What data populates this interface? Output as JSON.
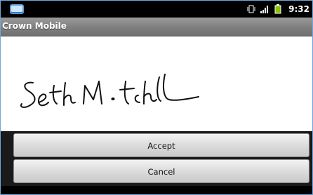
{
  "statusbar": {
    "left_icon": "android-system-icon",
    "icons": [
      "vibrate-icon",
      "signal-bars-icon",
      "battery-icon"
    ],
    "time": "9:32"
  },
  "app": {
    "title": "Crown Mobile"
  },
  "signature": {
    "text": "Seth Mitchell"
  },
  "buttons": {
    "accept_label": "Accept",
    "cancel_label": "Cancel"
  },
  "colors": {
    "statusbar_bg": "#000000",
    "titlebar_gradient_top": "#9a9a9a",
    "titlebar_gradient_bottom": "#707070",
    "canvas_bg": "#ffffff",
    "battery_green": "#86c30a",
    "frame_border": "#6fa7d8"
  }
}
